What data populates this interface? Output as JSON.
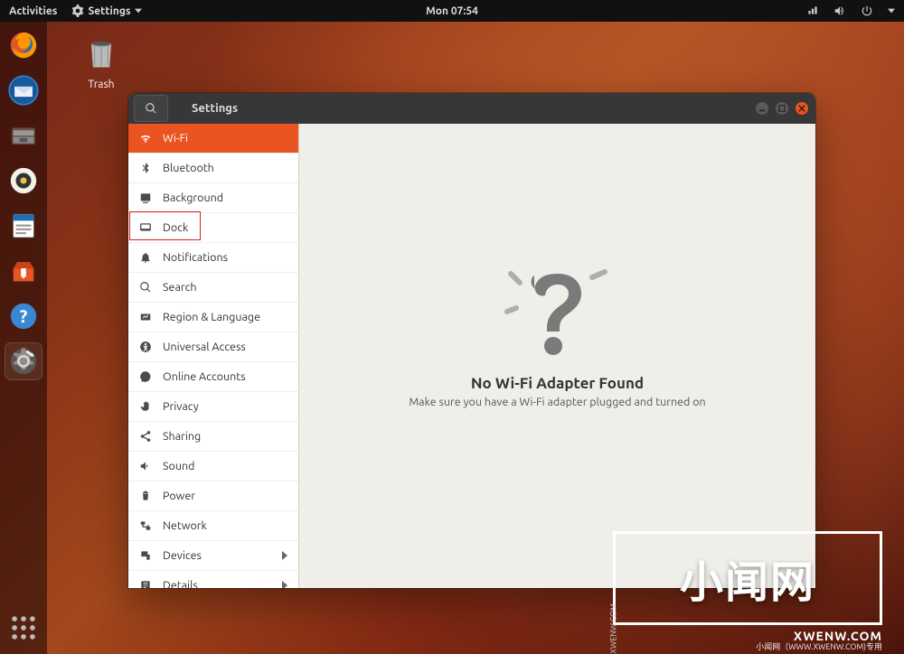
{
  "topbar": {
    "activities": "Activities",
    "app_menu": "Settings",
    "clock": "Mon 07:54"
  },
  "desktop": {
    "trash_label": "Trash"
  },
  "settings_window": {
    "title": "Settings",
    "sidebar": {
      "items": [
        {
          "id": "wifi",
          "label": "Wi-Fi",
          "icon": "wifi",
          "selected": true
        },
        {
          "id": "bluetooth",
          "label": "Bluetooth",
          "icon": "bluetooth"
        },
        {
          "id": "background",
          "label": "Background",
          "icon": "background"
        },
        {
          "id": "dock",
          "label": "Dock",
          "icon": "dock",
          "highlighted": true
        },
        {
          "id": "notifications",
          "label": "Notifications",
          "icon": "bell"
        },
        {
          "id": "search",
          "label": "Search",
          "icon": "search"
        },
        {
          "id": "region",
          "label": "Region & Language",
          "icon": "globe"
        },
        {
          "id": "universal",
          "label": "Universal Access",
          "icon": "accessibility"
        },
        {
          "id": "online",
          "label": "Online Accounts",
          "icon": "online"
        },
        {
          "id": "privacy",
          "label": "Privacy",
          "icon": "hand"
        },
        {
          "id": "sharing",
          "label": "Sharing",
          "icon": "share"
        },
        {
          "id": "sound",
          "label": "Sound",
          "icon": "speaker"
        },
        {
          "id": "power",
          "label": "Power",
          "icon": "power"
        },
        {
          "id": "network",
          "label": "Network",
          "icon": "network"
        },
        {
          "id": "devices",
          "label": "Devices",
          "icon": "devices",
          "chevron": true
        },
        {
          "id": "details",
          "label": "Details",
          "icon": "details",
          "chevron": true
        }
      ]
    },
    "content": {
      "title": "No Wi-Fi Adapter Found",
      "subtitle": "Make sure you have a Wi-Fi adapter plugged and turned on"
    }
  },
  "watermark": {
    "large": "小闻网",
    "sub": "XWENW.COM",
    "credit": "小闻网（WWW.XWENW.COM)专用",
    "side": "XWENW.COM"
  }
}
